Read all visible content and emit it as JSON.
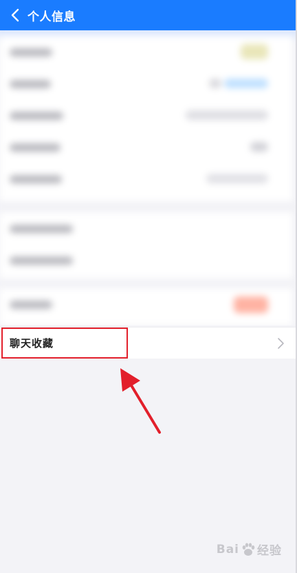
{
  "header": {
    "title": "个人信息"
  },
  "list": {
    "chat_favorites_label": "聊天收藏"
  },
  "watermark": {
    "text_left": "Bai",
    "text_right": "经验"
  },
  "colors": {
    "header_bg": "#1a7cff",
    "highlight_red": "#e21f2b",
    "page_bg": "#f3f3f7"
  },
  "icons": {
    "back": "chevron-left-icon",
    "row_chevron": "chevron-right-icon",
    "annotation": "red-arrow-icon",
    "watermark_logo": "paw-icon"
  }
}
